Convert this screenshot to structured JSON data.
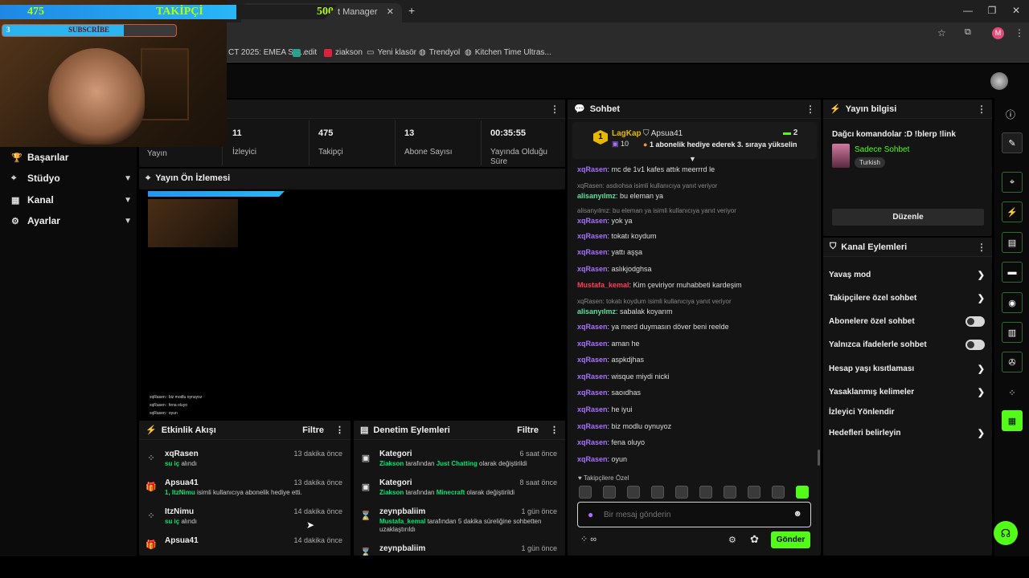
{
  "browser": {
    "tab_title": "t Manager",
    "bookmarks": [
      "CT 2025: EMEA Sta...",
      "edit",
      "ziakson",
      "Yeni klasör",
      "Trendyol",
      "Kitchen Time Ultras..."
    ],
    "profile_initial": "M"
  },
  "overlay": {
    "followers_current": "475",
    "followers_label": "TAKİPÇİ",
    "followers_goal": "500",
    "subs_current": "3",
    "subs_label": "SUBSCRİBE"
  },
  "nav": {
    "items": [
      {
        "label": "Başarılar",
        "icon": "trophy-icon",
        "expandable": false
      },
      {
        "label": "Stüdyo",
        "icon": "studio-icon",
        "expandable": true
      },
      {
        "label": "Kanal",
        "icon": "channel-icon",
        "expandable": true
      },
      {
        "label": "Ayarlar",
        "icon": "gear-icon",
        "expandable": true
      }
    ]
  },
  "stats": [
    {
      "value": "",
      "label": "Yayın"
    },
    {
      "value": "11",
      "label": "İzleyici"
    },
    {
      "value": "475",
      "label": "Takipçi"
    },
    {
      "value": "13",
      "label": "Abone Sayısı"
    },
    {
      "value": "00:35:55",
      "label": "Yayında Olduğu Süre"
    }
  ],
  "preview": {
    "title": "Yayın Ön İzlemesi",
    "mini_chat": [
      "xqRasen : biz modlu oynuyoz",
      "xqRasen : fena oluyo",
      "xqRasen : oyun"
    ]
  },
  "activity": {
    "title": "Etkinlik Akışı",
    "filter": "Filtre",
    "items": [
      {
        "name": "xqRasen",
        "time": "13 dakika önce",
        "desc_highlight": "su iç",
        "desc_rest": " alındı",
        "icon": "points-icon"
      },
      {
        "name": "Apsua41",
        "time": "13 dakika önce",
        "desc_highlight": "1, ItzNimu",
        "desc_rest": " isimli kullanıcıya abonelik hediye etti.",
        "icon": "gift-icon"
      },
      {
        "name": "ItzNimu",
        "time": "14 dakika önce",
        "desc_highlight": "su iç",
        "desc_rest": " alındı",
        "icon": "points-icon"
      },
      {
        "name": "Apsua41",
        "time": "14 dakika önce",
        "desc_highlight": "",
        "desc_rest": "",
        "icon": "gift-icon"
      }
    ]
  },
  "moderation": {
    "title": "Denetim Eylemleri",
    "filter": "Filtre",
    "items": [
      {
        "name": "Kategori",
        "time": "6 saat önce",
        "actor": "Ziakson",
        "mid": " tarafından ",
        "target": "Just Chatting",
        "end": " olarak değiştirildi",
        "icon": "category-icon"
      },
      {
        "name": "Kategori",
        "time": "8 saat önce",
        "actor": "Ziakson",
        "mid": " tarafından ",
        "target": "Minecraft",
        "end": " olarak değiştirildi",
        "icon": "category-icon"
      },
      {
        "name": "zeynpbaliim",
        "time": "1 gün önce",
        "actor": "Mustafa_kemal",
        "mid": " tarafından 5 dakika süreliğine sohbetten uzaklaştırıldı",
        "target": "",
        "end": "",
        "icon": "hourglass-icon"
      },
      {
        "name": "zeynpbaliim",
        "time": "1 gün önce",
        "actor": "",
        "mid": "",
        "target": "",
        "end": "",
        "icon": "hourglass-icon"
      }
    ]
  },
  "chat": {
    "title": "Sohbet",
    "pinned": {
      "rank": "1",
      "user": "LagKap",
      "sub_count": "10",
      "gifter": "Apsua41",
      "gift_count": "2",
      "message": "1 abonelik hediye ederek 3. sıraya yükselin"
    },
    "messages": [
      {
        "reply": "",
        "user": "xqRasen",
        "text": ": mc de 1v1 kafes attık meerrrd le",
        "style": "u"
      },
      {
        "reply": "xqRasen: asdıohsa isimli kullanıcıya yanıt veriyor",
        "user": "alisanyılmz",
        "text": ": bu eleman ya",
        "style": "u2"
      },
      {
        "reply": "alisanyılmz: bu eleman ya isimli kullanıcıya yanıt veriyor",
        "user": "xqRasen",
        "text": ": yok ya",
        "style": "u"
      },
      {
        "reply": "",
        "user": "xqRasen",
        "text": ": tokatı koydum",
        "style": "u"
      },
      {
        "reply": "",
        "user": "xqRasen",
        "text": ": yattı aşşa",
        "style": "u"
      },
      {
        "reply": "",
        "user": "xqRasen",
        "text": ": aslıkjodghsa",
        "style": "u"
      },
      {
        "reply": "",
        "user": "Mustafa_kemal",
        "text": ": Kim çeviriyor muhabbeti kardeşim",
        "style": "u3"
      },
      {
        "reply": "xqRasen: tokatı koydum isimli kullanıcıya yanıt veriyor",
        "user": "alisanyılmz",
        "text": ": sabalak koyarım",
        "style": "u2"
      },
      {
        "reply": "",
        "user": "xqRasen",
        "text": ": ya merd duymasın döver beni reelde",
        "style": "u"
      },
      {
        "reply": "",
        "user": "xqRasen",
        "text": ": aman he",
        "style": "u"
      },
      {
        "reply": "",
        "user": "xqRasen",
        "text": ": aspkdjhas",
        "style": "u"
      },
      {
        "reply": "",
        "user": "xqRasen",
        "text": ": wisque miydi nicki",
        "style": "u"
      },
      {
        "reply": "",
        "user": "xqRasen",
        "text": ": saoıdhas",
        "style": "u"
      },
      {
        "reply": "",
        "user": "xqRasen",
        "text": ": he iyui",
        "style": "u"
      },
      {
        "reply": "",
        "user": "xqRasen",
        "text": ": biz modlu oynuyoz",
        "style": "u"
      },
      {
        "reply": "",
        "user": "xqRasen",
        "text": ": fena oluyo",
        "style": "u"
      },
      {
        "reply": "",
        "user": "xqRasen",
        "text": ": oyun",
        "style": "u"
      }
    ],
    "emotes_label": "Takipçilere Özel",
    "input_placeholder": "Bir mesaj gönderin",
    "send_label": "Gönder",
    "points_value": "∞"
  },
  "stream_info": {
    "title": "Yayın bilgisi",
    "stream_title": "Dağcı komandolar :D !blerp !link",
    "category": "Sadece Sohbet",
    "tag": "Turkish",
    "edit_label": "Düzenle"
  },
  "channel_actions": {
    "title": "Kanal Eylemleri",
    "items": [
      {
        "label": "Yavaş mod",
        "control": "arrow"
      },
      {
        "label": "Takipçilere özel sohbet",
        "control": "arrow"
      },
      {
        "label": "Abonelere özel sohbet",
        "control": "toggle"
      },
      {
        "label": "Yalnızca ifadelerle sohbet",
        "control": "toggle"
      },
      {
        "label": "Hesap yaşı kısıtlaması",
        "control": "arrow"
      },
      {
        "label": "Yasaklanmış kelimeler",
        "control": "arrow"
      },
      {
        "label": "İzleyici Yönlendir",
        "control": "none"
      },
      {
        "label": "Hedefleri belirleyin",
        "control": "arrow"
      }
    ]
  },
  "colors": {
    "accent": "#53fc18",
    "sub_purple": "#a970ff",
    "green_user": "#5ae0a0",
    "red_user": "#ff3b5c"
  }
}
